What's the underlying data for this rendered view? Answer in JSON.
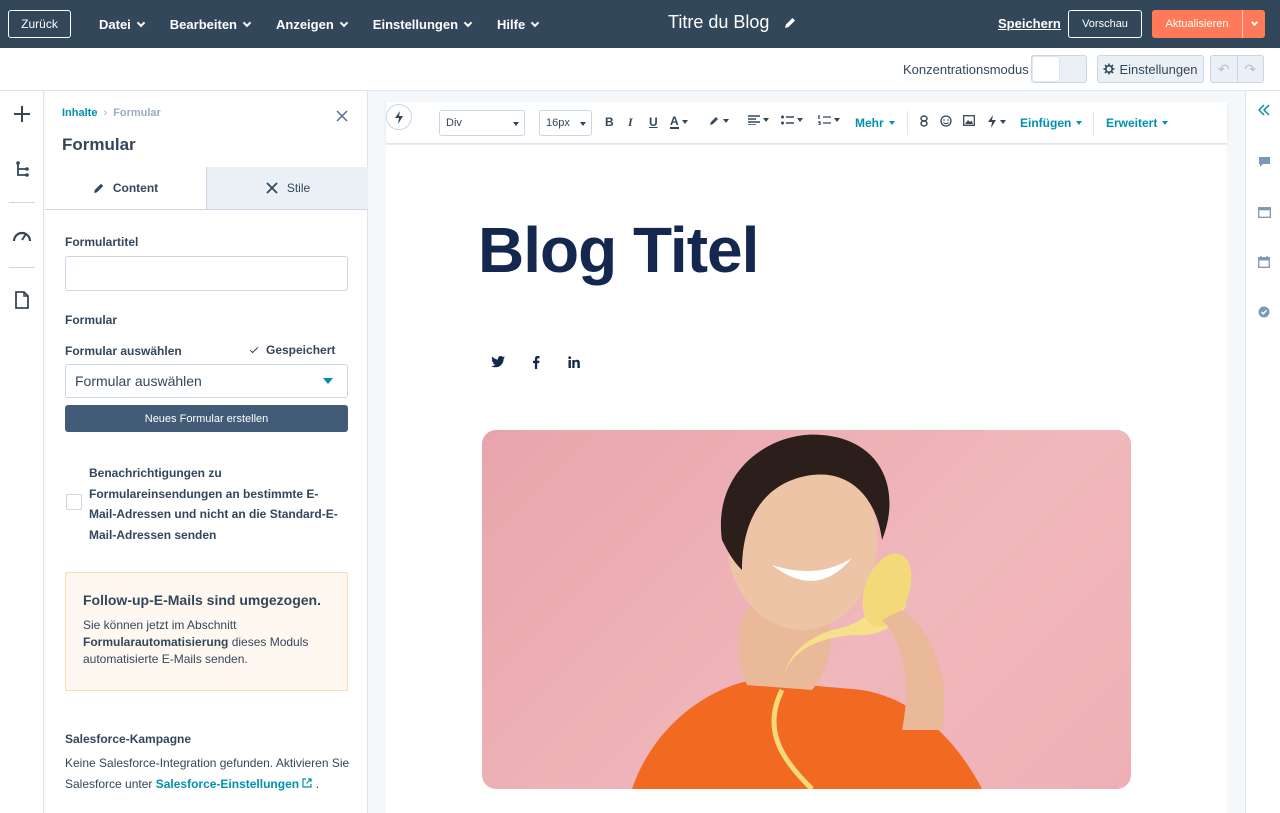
{
  "topbar": {
    "back_label": "Zurück",
    "menu": [
      {
        "label": "Datei"
      },
      {
        "label": "Bearbeiten"
      },
      {
        "label": "Anzeigen"
      },
      {
        "label": "Einstellungen"
      },
      {
        "label": "Hilfe"
      }
    ],
    "doc_title": "Titre du Blog",
    "save_label": "Speichern",
    "preview_label": "Vorschau",
    "update_label": "Aktualisieren"
  },
  "subbar": {
    "focus_mode_label": "Konzentrationsmodus",
    "focus_mode_on": false,
    "settings_label": "Einstellungen"
  },
  "panel": {
    "breadcrumb": {
      "root": "Inhalte",
      "current": "Formular"
    },
    "title": "Formular",
    "tabs": [
      {
        "label": "Content",
        "active": true
      },
      {
        "label": "Stile",
        "active": false
      }
    ],
    "form_title_label": "Formulartitel",
    "form_title_value": "",
    "form_section_label": "Formular",
    "select_form_label": "Formular auswählen",
    "saved_label": "Gespeichert",
    "select_value": "Formular auswählen",
    "new_form_button": "Neues Formular erstellen",
    "notify_checkbox_label": "Benachrichtigungen zu Formulareinsendungen an bestimmte E-Mail-Adressen und nicht an die Standard-E-Mail-Adressen senden",
    "notify_checked": false,
    "callout": {
      "title": "Follow-up-E-Mails sind umgezogen.",
      "text_before": "Sie können jetzt im Abschnitt ",
      "text_bold": "Formularautomatisierung",
      "text_after": " dieses Moduls automatisierte E-Mails senden."
    },
    "salesforce": {
      "title": "Salesforce-Kampagne",
      "text": "Keine Salesforce-Integration gefunden. Aktivieren Sie Salesforce unter ",
      "link": "Salesforce-Einstellungen",
      "text_end": " ."
    }
  },
  "editor_toolbar": {
    "block_select": "Div",
    "size_select": "16px",
    "more_label": "Mehr",
    "insert_label": "Einfügen",
    "advanced_label": "Erweitert"
  },
  "page": {
    "blog_title": "Blog Titel"
  },
  "colors": {
    "topbar": "#33475b",
    "accent": "#ff7a59",
    "link": "#0091ae",
    "title": "#14274e"
  }
}
